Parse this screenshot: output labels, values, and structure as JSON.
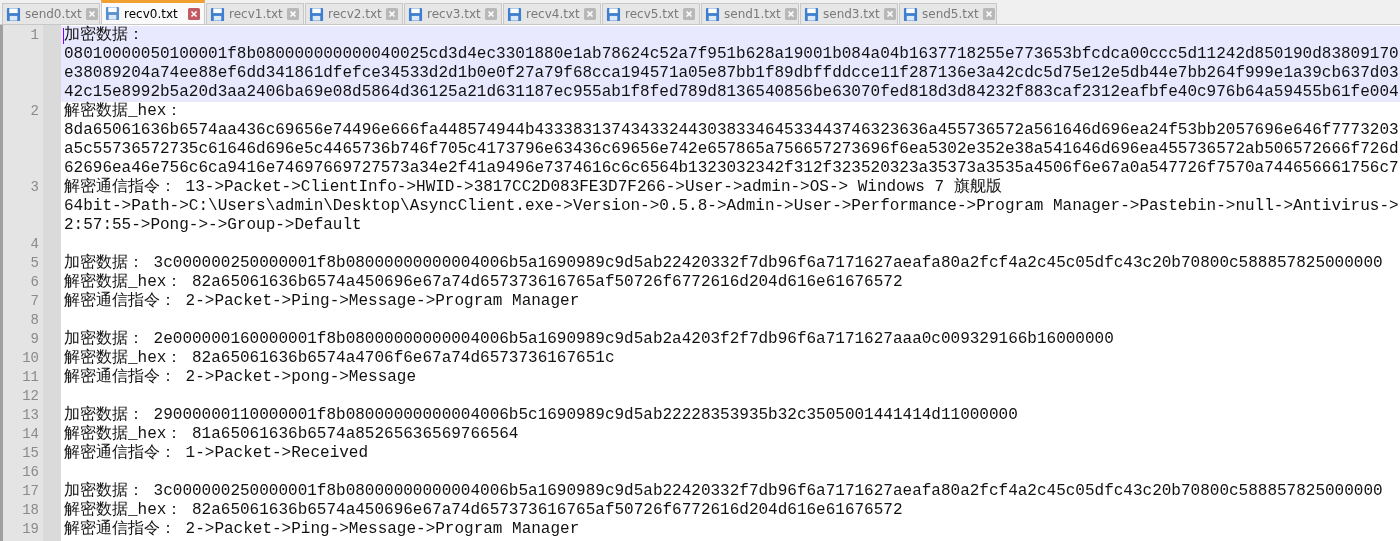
{
  "tabs": [
    {
      "label": "send0.txt",
      "selected": false
    },
    {
      "label": "recv0.txt",
      "selected": true
    },
    {
      "label": "recv1.txt",
      "selected": false
    },
    {
      "label": "recv2.txt",
      "selected": false
    },
    {
      "label": "recv3.txt",
      "selected": false
    },
    {
      "label": "recv4.txt",
      "selected": false
    },
    {
      "label": "recv5.txt",
      "selected": false
    },
    {
      "label": "send1.txt",
      "selected": false
    },
    {
      "label": "send3.txt",
      "selected": false
    },
    {
      "label": "send5.txt",
      "selected": false
    }
  ],
  "editor": {
    "lines": [
      {
        "number": "1",
        "current": true,
        "rows": [
          "加密数据：",
          "08010000050100001f8b080000000000040025cd3d4ec3301880e1ab78624c52a7f951b628a19001b084a04b1637718255e773653bfcdca00ccc5d11242d850190d83809170",
          "e38089204a74ee88ef6dd341861dfefce34533d2d1b0e0f27a79f68cca194571a05e87bb1f89dbffddcce11f287136e3a42cdc5d75e12e5db44e7bb264f999e1a39cb637d03",
          "42c15e8992b5a20d3aa2406ba69e08d5864d36125a21d631187ec955ab1f8fed789d8136540856be63070fed818d3d84232f883caf2312eafbfe40c976b64a59455b61fe004"
        ]
      },
      {
        "number": "2",
        "current": false,
        "rows": [
          "解密数据_hex：",
          "8da65061636b6574aa436c69656e74496e666fa448574944b43338313743433244303833464533443746323636a455736572a561646d696ea24f53bb2057696e646f7773203",
          "a5c55736572735c61646d696e5c4465736b746f705c4173796e63436c69656e742e657865a756657273696f6ea5302e352e38a541646d696ea455736572ab506572666f726d",
          "62696ea46e756c6ca9416e74697669727573a34e2f41a9496e7374616c6c6564b1323032342f312f323520323a35373a3535a4506f6e67a0a547726f7570a744656661756c7"
        ]
      },
      {
        "number": "3",
        "current": false,
        "rows": [
          "解密通信指令： 13->Packet->ClientInfo->HWID->3817CC2D083FE3D7F266->User->admin->OS-> Windows 7 旗舰版",
          "64bit->Path->C:\\Users\\admin\\Desktop\\AsyncClient.exe->Version->0.5.8->Admin->User->Performance->Program Manager->Pastebin->null->Antivirus->",
          "2:57:55->Pong->->Group->Default"
        ]
      },
      {
        "number": "4",
        "current": false
      },
      {
        "number": "5",
        "current": false,
        "rows": [
          "加密数据： 3c000000250000001f8b08000000000004006b5a1690989c9d5ab22420332f7db96f6a7171627aeafa80a2fcf4a2c45c05dfc43c20b70800c588857825000000"
        ]
      },
      {
        "number": "6",
        "current": false,
        "rows": [
          "解密数据_hex： 82a65061636b6574a450696e67a74d657373616765af50726f6772616d204d616e61676572"
        ]
      },
      {
        "number": "7",
        "current": false,
        "rows": [
          "解密通信指令： 2->Packet->Ping->Message->Program Manager"
        ]
      },
      {
        "number": "8",
        "current": false
      },
      {
        "number": "9",
        "current": false,
        "rows": [
          "加密数据： 2e000000160000001f8b08000000000004006b5a1690989c9d5ab2a4203f2f7db96f6a7171627aaa0c009329166b16000000"
        ]
      },
      {
        "number": "10",
        "current": false,
        "rows": [
          "解密数据_hex： 82a65061636b6574a4706f6e67a74d6573736167651c"
        ]
      },
      {
        "number": "11",
        "current": false,
        "rows": [
          "解密通信指令： 2->Packet->pong->Message"
        ]
      },
      {
        "number": "12",
        "current": false
      },
      {
        "number": "13",
        "current": false,
        "rows": [
          "加密数据： 29000000110000001f8b08000000000004006b5c1690989c9d5ab22228353935b32c3505001441414d11000000"
        ]
      },
      {
        "number": "14",
        "current": false,
        "rows": [
          "解密数据_hex： 81a65061636b6574a85265636569766564"
        ]
      },
      {
        "number": "15",
        "current": false,
        "rows": [
          "解密通信指令： 1->Packet->Received"
        ]
      },
      {
        "number": "16",
        "current": false
      },
      {
        "number": "17",
        "current": false,
        "rows": [
          "加密数据： 3c000000250000001f8b08000000000004006b5a1690989c9d5ab22420332f7db96f6a7171627aeafa80a2fcf4a2c45c05dfc43c20b70800c588857825000000"
        ]
      },
      {
        "number": "18",
        "current": false,
        "rows": [
          "解密数据_hex： 82a65061636b6574a450696e67a74d657373616765af50726f6772616d204d616e61676572"
        ]
      },
      {
        "number": "19",
        "current": false,
        "rows": [
          "解密通信指令： 2->Packet->Ping->Message->Program Manager"
        ]
      }
    ]
  }
}
